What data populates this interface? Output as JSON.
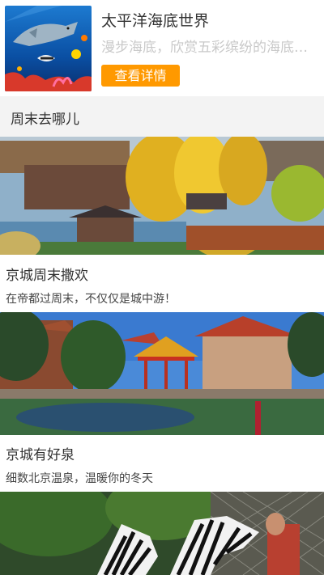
{
  "promo": {
    "title": "太平洋海底世界",
    "description": "漫步海底，欣赏五彩缤纷的海底世界",
    "button_label": "查看详情",
    "accent_color": "#ff9900"
  },
  "section": {
    "title": "周末去哪儿"
  },
  "articles": [
    {
      "title": "京城周末撒欢",
      "subtitle": "在帝都过周末，不仅仅是城中游！",
      "image": "autumn-palace-photo"
    },
    {
      "title": "京城有好泉",
      "subtitle": "细数北京温泉，温暖你的冬天",
      "image": "pavilion-pond-photo"
    },
    {
      "title": "",
      "subtitle": "",
      "image": "zebra-zoo-photo"
    }
  ]
}
